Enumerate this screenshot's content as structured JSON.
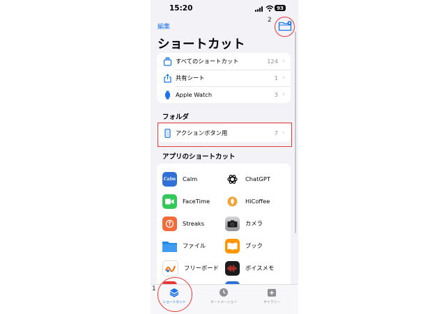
{
  "status": {
    "time": "15:20",
    "battery": "93"
  },
  "header": {
    "edit_label": "編集",
    "title": "ショートカット"
  },
  "library": [
    {
      "label": "すべてのショートカット",
      "count": "124",
      "icon": "stack-icon"
    },
    {
      "label": "共有シート",
      "count": "1",
      "icon": "share-icon"
    },
    {
      "label": "Apple Watch",
      "count": "3",
      "icon": "watch-icon"
    }
  ],
  "folders": {
    "header": "フォルダ",
    "items": [
      {
        "label": "アクションボタン用",
        "count": "7",
        "icon": "phone-icon"
      }
    ]
  },
  "apps": {
    "header": "アプリのショートカット",
    "items": [
      {
        "name": "Calm",
        "icon": "calm-icon",
        "color": "#2f6fd6"
      },
      {
        "name": "ChatGPT",
        "icon": "chatgpt-icon",
        "color": "#ffffff"
      },
      {
        "name": "FaceTime",
        "icon": "facetime-icon",
        "color": "#34c759"
      },
      {
        "name": "HiCoffee",
        "icon": "hicoffee-icon",
        "color": "#f2a33a"
      },
      {
        "name": "Streaks",
        "icon": "streaks-icon",
        "color": "#f26b3a"
      },
      {
        "name": "カメラ",
        "icon": "camera-icon",
        "color": "#9a9a9f"
      },
      {
        "name": "ファイル",
        "icon": "files-icon",
        "color": "#1e88e5"
      },
      {
        "name": "ブック",
        "icon": "books-icon",
        "color": "#ff9500"
      },
      {
        "name": "フリーボード",
        "icon": "freeform-icon",
        "color": "#ffffff"
      },
      {
        "name": "ボイスメモ",
        "icon": "voice-memo-icon",
        "color": "#1c1c1e"
      }
    ]
  },
  "tabs": [
    {
      "label": "ショートカット",
      "icon": "shortcuts-icon",
      "active": true
    },
    {
      "label": "オートメーション",
      "icon": "automation-icon",
      "active": false
    },
    {
      "label": "ギャラリー",
      "icon": "gallery-icon",
      "active": false
    }
  ],
  "annotations": {
    "callout_1": "1",
    "callout_2": "2"
  },
  "colors": {
    "accent": "#1a73e8",
    "callout": "#e53935",
    "background": "#f2f2f7"
  }
}
